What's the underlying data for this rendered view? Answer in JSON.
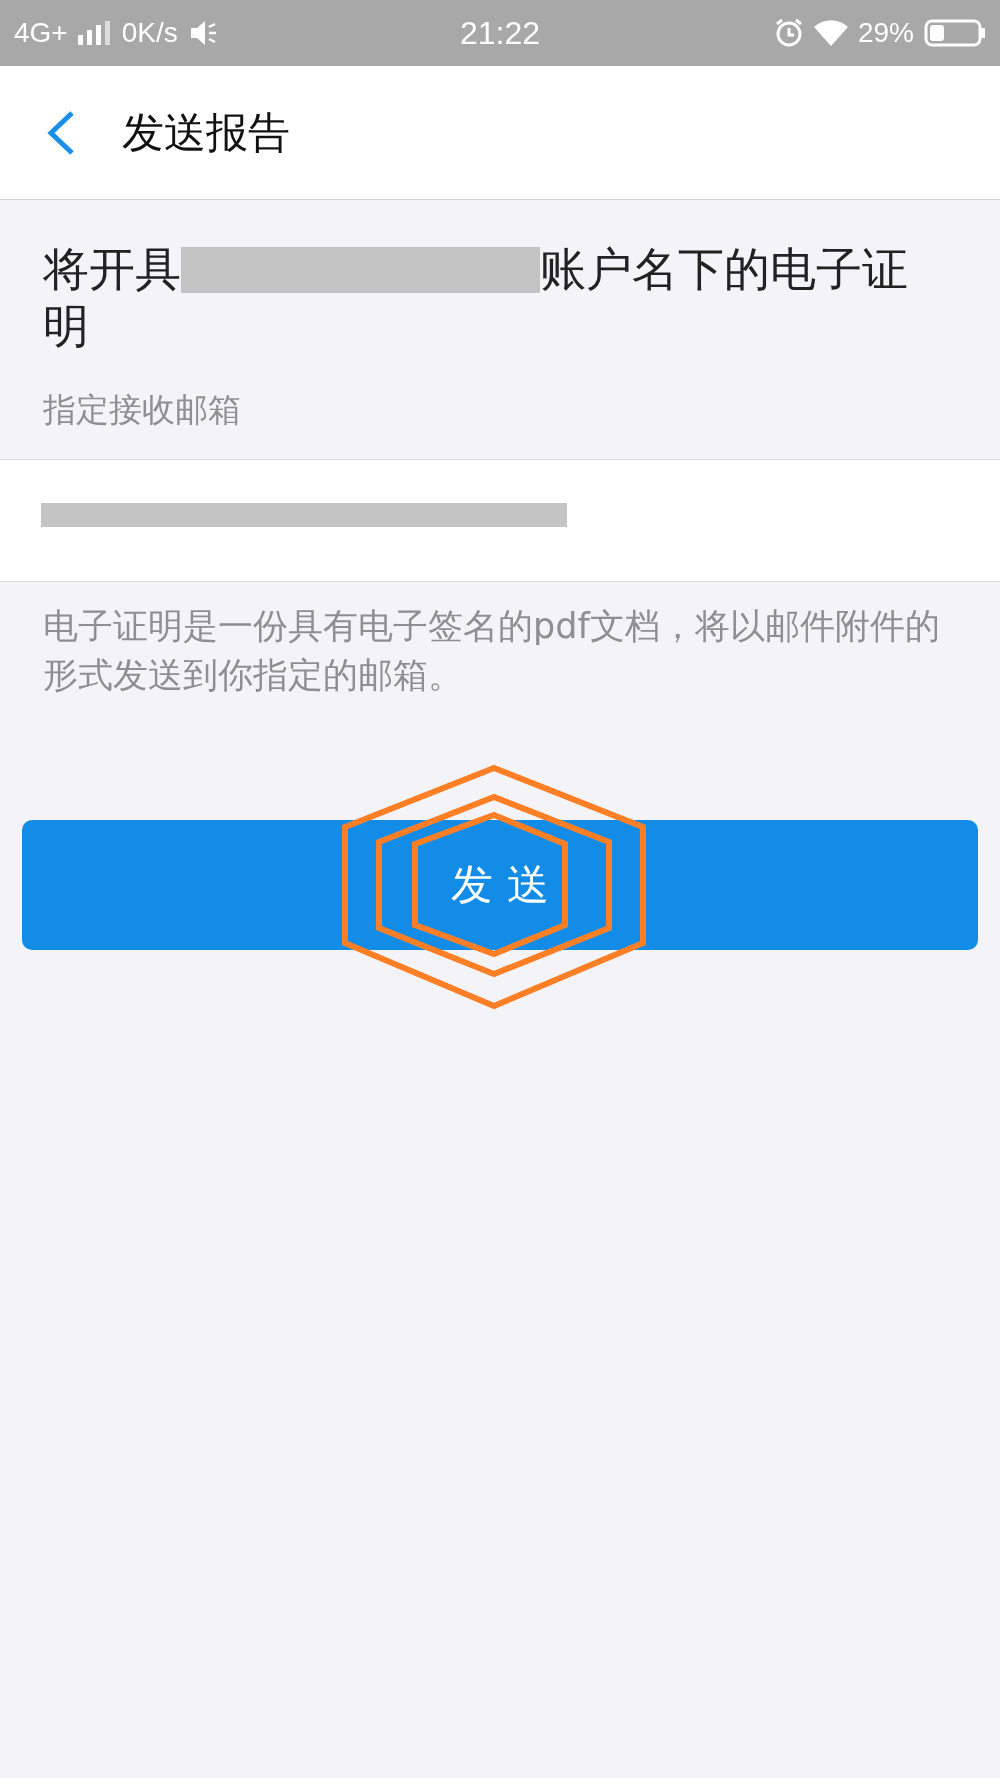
{
  "status_bar": {
    "network": "4G+",
    "speed": "0K/s",
    "time": "21:22",
    "battery": "29%"
  },
  "header": {
    "title": "发送报告"
  },
  "statement": {
    "prefix": "将开具",
    "suffix": "账户名下的电子证",
    "continuation": "明"
  },
  "email": {
    "label": "指定接收邮箱"
  },
  "note": "电子证明是一份具有电子签名的pdf文档，将以邮件附件的形式发送到你指定的邮箱。",
  "send_button": {
    "label": "发 送"
  }
}
